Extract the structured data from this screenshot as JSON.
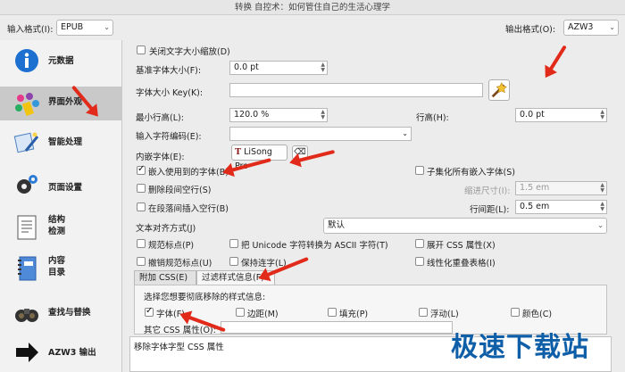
{
  "window": {
    "title": "转换 自控术：如何管住自己的生活心理学"
  },
  "toolbar": {
    "input_format_label": "输入格式(I):",
    "input_format_value": "EPUB",
    "output_format_label": "输出格式(O):",
    "output_format_value": "AZW3"
  },
  "sidebar": {
    "items": [
      {
        "label": "元数据",
        "icon": "info-icon"
      },
      {
        "label": "界面外观",
        "icon": "palette-icon",
        "active": true
      },
      {
        "label": "智能处理",
        "icon": "wand-icon"
      },
      {
        "label": "页面设置",
        "icon": "gear-icon"
      },
      {
        "label_line1": "结构",
        "label_line2": "检测",
        "icon": "document-icon"
      },
      {
        "label_line1": "内容",
        "label_line2": "目录",
        "icon": "notebook-icon"
      },
      {
        "label": "查找与替换",
        "icon": "binoculars-icon"
      },
      {
        "label": "AZW3 输出",
        "icon": "arrow-right-icon"
      }
    ]
  },
  "options": {
    "disable_font_rescale": "关闭文字大小缩放(D)",
    "base_font_size_label": "基准字体大小(F):",
    "base_font_size_value": "0.0 pt",
    "font_size_key_label": "字体大小 Key(K):",
    "font_size_key_value": "",
    "min_line_height_label": "最小行高(L):",
    "min_line_height_value": "120.0 %",
    "line_height_label": "行高(H):",
    "line_height_value": "0.0 pt",
    "input_encoding_label": "输入字符编码(E):",
    "input_encoding_value": "",
    "embed_font_label": "内嵌字体(E):",
    "embed_font_value": "LiSong Pro",
    "embed_all_fonts": {
      "label": "嵌入使用到的字体(B)",
      "checked": true
    },
    "subset_fonts": {
      "label": "子集化所有嵌入字体(S)",
      "checked": false
    },
    "remove_spacing": {
      "label": "删除段间空行(S)",
      "checked": false
    },
    "indent_size_label": "缩进尺寸(I):",
    "indent_size_value": "1.5 em",
    "insert_blank_line": {
      "label": "在段落间插入空行(B)",
      "checked": false
    },
    "line_spacing_label": "行间距(L):",
    "line_spacing_value": "0.5 em",
    "text_align_label": "文本对齐方式(J)",
    "text_align_value": "默认",
    "smarten_punct": {
      "label": "规范标点(P)",
      "checked": false
    },
    "unicode_ascii": {
      "label": "把 Unicode 字符转换为 ASCII 字符(T)",
      "checked": false
    },
    "expand_css": {
      "label": "展开 CSS 属性(X)",
      "checked": false
    },
    "unsmarten_punct": {
      "label": "撤销规范标点(U)",
      "checked": false
    },
    "keep_ligatures": {
      "label": "保持连字(L)",
      "checked": false
    },
    "linearize_tables": {
      "label": "线性化重叠表格(I)",
      "checked": false
    }
  },
  "tabs": [
    {
      "label": "附加 CSS(E)"
    },
    {
      "label": "过滤样式信息(F)",
      "active": true
    }
  ],
  "filter": {
    "prompt": "选择您想要彻底移除的样式信息:",
    "items": [
      {
        "label": "字体(F)",
        "checked": true
      },
      {
        "label": "边距(M)",
        "checked": false
      },
      {
        "label": "填充(P)",
        "checked": false
      },
      {
        "label": "浮动(L)",
        "checked": false
      },
      {
        "label": "颜色(C)",
        "checked": false
      }
    ],
    "other_css_label": "其它 CSS 属性(O):"
  },
  "description": "移除字体字型 CSS 属性",
  "watermark": "极速下载站"
}
